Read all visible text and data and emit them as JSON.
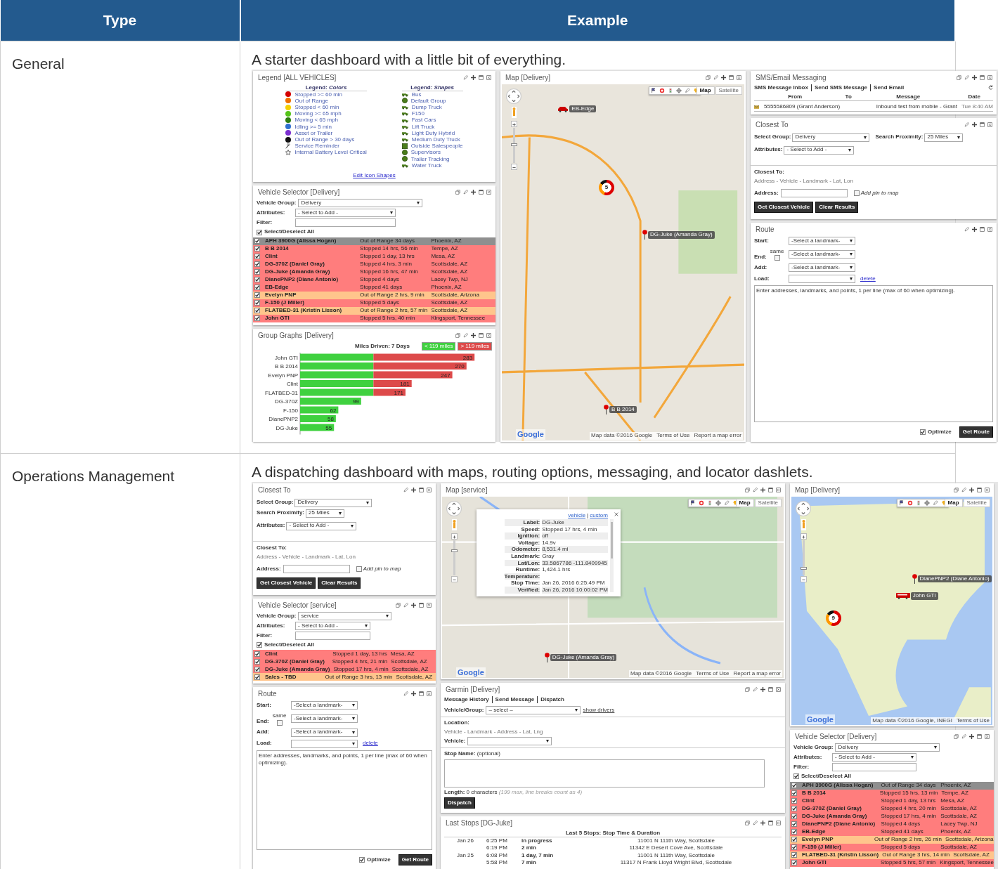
{
  "table": {
    "columns": [
      "Type",
      "Example"
    ],
    "rows": [
      {
        "type": "General",
        "description": "A starter dashboard with a little bit of everything.",
        "dashboard": {
          "columns": [
            [
              {
                "kind": "legend",
                "title": "Legend  [ALL VEHICLES]",
                "copyable": false,
                "colors_heading": "Legend: *Colors*",
                "colors": [
                  {
                    "kind": "dot",
                    "label": "Stopped >= 60 min",
                    "color": "#d40000"
                  },
                  {
                    "kind": "dot",
                    "label": "Out of Range",
                    "color": "#f07000"
                  },
                  {
                    "kind": "dot",
                    "label": "Stopped < 60 min",
                    "color": "#f5d000"
                  },
                  {
                    "kind": "dot",
                    "label": "Moving >= 65 mph",
                    "color": "#55c41a"
                  },
                  {
                    "kind": "dot",
                    "label": "Moving < 65 mph",
                    "color": "#2e7d10"
                  },
                  {
                    "kind": "dot",
                    "label": "Idling >= 5 min",
                    "color": "#2f6fd0"
                  },
                  {
                    "kind": "dot",
                    "label": "Asset or Trailer",
                    "color": "#7b2fd0"
                  },
                  {
                    "kind": "dot",
                    "label": "Out of Range > 30 days",
                    "color": "#111111"
                  },
                  {
                    "kind": "wrench",
                    "label": "Service Reminder"
                  },
                  {
                    "kind": "star",
                    "label": "Internal Battery Level Critical"
                  }
                ],
                "shapes_heading": "Legend: *Shapes*",
                "shapes": [
                  {
                    "kind": "vehicle",
                    "label": "Bus"
                  },
                  {
                    "kind": "circle",
                    "label": "Default Group"
                  },
                  {
                    "kind": "vehicle",
                    "label": "Dump Truck"
                  },
                  {
                    "kind": "vehicle",
                    "label": "F150"
                  },
                  {
                    "kind": "vehicle",
                    "label": "Fast Cars"
                  },
                  {
                    "kind": "vehicle",
                    "label": "Lift Truck"
                  },
                  {
                    "kind": "vehicle",
                    "label": "Light Duty Hybrid"
                  },
                  {
                    "kind": "vehicle",
                    "label": "Medium Duty Truck"
                  },
                  {
                    "kind": "square",
                    "label": "Outside Salespeople"
                  },
                  {
                    "kind": "circle",
                    "label": "Supervisors"
                  },
                  {
                    "kind": "circle",
                    "label": "Trailer Tracking"
                  },
                  {
                    "kind": "vehicle",
                    "label": "Water Truck"
                  }
                ],
                "link": "Edit Icon Shapes"
              },
              {
                "kind": "vehicle_selector",
                "title": "Vehicle Selector  [Delivery]",
                "copyable": true,
                "fields": [
                  {
                    "kind": "select",
                    "label": "Vehicle Group:",
                    "value": "Delivery"
                  },
                  {
                    "kind": "select",
                    "label": "Attributes:",
                    "value": "- Select to Add -"
                  },
                  {
                    "kind": "text",
                    "label": "Filter:"
                  }
                ],
                "select_all": {
                  "label": "Select/Deselect All",
                  "checked": true
                },
                "rows": [
                  {
                    "name": "APH 3900G (Alissa Hogan)",
                    "status": "Out of Range 34 days",
                    "location": "Phoenix, AZ",
                    "color": "#8f8f8f",
                    "checked": true
                  },
                  {
                    "name": "B B 2014",
                    "status": "Stopped 14 hrs, 56 min",
                    "location": "Tempe, AZ",
                    "color": "#ff7d7d",
                    "checked": true
                  },
                  {
                    "name": "Clint",
                    "status": "Stopped 1 day, 13 hrs",
                    "location": "Mesa, AZ",
                    "color": "#ff7d7d",
                    "checked": true
                  },
                  {
                    "name": "DG-370Z (Daniel Gray)",
                    "status": "Stopped 4 hrs, 3 min",
                    "location": "Scottsdale, AZ",
                    "color": "#ff7d7d",
                    "checked": true
                  },
                  {
                    "name": "DG-Juke (Amanda Gray)",
                    "status": "Stopped 16 hrs, 47 min",
                    "location": "Scottsdale, AZ",
                    "color": "#ff7d7d",
                    "checked": true
                  },
                  {
                    "name": "DianePNP2 (Diane Antonio)",
                    "status": "Stopped 4 days",
                    "location": "Lacey Twp, NJ",
                    "color": "#ff7d7d",
                    "checked": true
                  },
                  {
                    "name": "EB-Edge",
                    "status": "Stopped 41 days",
                    "location": "Phoenix, AZ",
                    "color": "#ff7d7d",
                    "checked": true
                  },
                  {
                    "name": "Evelyn PNP",
                    "status": "Out of Range 2 hrs, 9 min",
                    "location": "Scottsdale, Arizona",
                    "color": "#ffc58c",
                    "checked": true
                  },
                  {
                    "name": "F-150 (J Miller)",
                    "status": "Stopped 5 days",
                    "location": "Scottsdale, AZ",
                    "color": "#ff7d7d",
                    "checked": true
                  },
                  {
                    "name": "FLATBED-31 (Kristin Lisson)",
                    "status": "Out of Range 2 hrs, 57 min",
                    "location": "Scottsdale, AZ",
                    "color": "#ffc58c",
                    "checked": true
                  },
                  {
                    "name": "John GTI",
                    "status": "Stopped 5 hrs, 40 min",
                    "location": "Kingsport, Tennessee",
                    "color": "#ff7d7d",
                    "checked": true
                  }
                ]
              },
              {
                "kind": "group_graph",
                "title": "Group Graphs  [Delivery]",
                "copyable": true,
                "caption": "Miles Driven: 7 Days",
                "chart_data": {
                  "type": "bar",
                  "orientation": "horizontal",
                  "stacked": true,
                  "categories": [
                    "John GTI",
                    "B B 2014",
                    "Evelyn PNP",
                    "Clint",
                    "FLATBED-31",
                    "DG-370Z",
                    "F-150",
                    "DianePNP2",
                    "DG-Juke"
                  ],
                  "series": [
                    {
                      "name": "< 119 miles",
                      "color": "#3fd13f",
                      "values": [
                        119,
                        119,
                        119,
                        119,
                        119,
                        99,
                        62,
                        58,
                        55
                      ],
                      "value_labels": [
                        null,
                        null,
                        null,
                        null,
                        null,
                        "99",
                        "62",
                        "58",
                        "55"
                      ]
                    },
                    {
                      "name": "> 119 miles",
                      "color": "#dd4a4a",
                      "values": [
                        164,
                        151,
                        128,
                        62,
                        52,
                        null,
                        null,
                        null,
                        null
                      ]
                    }
                  ],
                  "annotations": [
                    {
                      "y": "John GTI",
                      "x": 283,
                      "text": "283"
                    },
                    {
                      "y": "B B 2014",
                      "x": 270,
                      "text": "270"
                    },
                    {
                      "y": "Evelyn PNP",
                      "x": 247,
                      "text": "247"
                    },
                    {
                      "y": "Clint",
                      "x": 181,
                      "text": "181"
                    },
                    {
                      "y": "FLATBED-31",
                      "x": 171,
                      "text": "171"
                    }
                  ]
                }
              }
            ],
            [
              {
                "kind": "map",
                "title": "Map  [Delivery]",
                "copyable": true,
                "zoom": {
                  "level": 0.52
                },
                "map_types": [
                  {
                    "label": "Map",
                    "selected": true
                  },
                  {
                    "label": "Satellite",
                    "selected": false
                  }
                ],
                "markers": [
                  {
                    "kind": "car",
                    "label": "EB-Edge"
                  },
                  {
                    "kind": "cluster",
                    "label": "5"
                  },
                  {
                    "kind": "pin",
                    "label": "DG-Juke (Amanda Gray)"
                  },
                  {
                    "kind": "pin",
                    "label": "B B 2014"
                  }
                ],
                "logo": "Google",
                "attribution": [
                  "Map data ©2016 Google",
                  "Terms of Use",
                  "Report a map error"
                ]
              }
            ],
            [
              {
                "kind": "sms",
                "title": "SMS/Email Messaging",
                "copyable": true,
                "tabs": [
                  "SMS Message Inbox",
                  "Send SMS Message",
                  "Send Email"
                ],
                "columns": [
                  "From",
                  "To",
                  "Message",
                  "Date"
                ],
                "rows": [
                  {
                    "from": "5555586809 (Grant Anderson)",
                    "message": "Inbound test from mobile - Grant",
                    "date": "Tue 8:40 AM"
                  }
                ]
              },
              {
                "kind": "closest_to",
                "title": "Closest To",
                "copyable": false,
                "fields": [
                  {
                    "kind": "select",
                    "label": "Select Group:",
                    "value": "Delivery"
                  },
                  {
                    "kind": "select",
                    "label": "Search Proximity:",
                    "value": "25 Miles"
                  },
                  {
                    "kind": "select",
                    "label": "Attributes:",
                    "value": "- Select to Add -"
                  }
                ],
                "target_heading": "Closest To:",
                "target_options": "Address  -  Vehicle  -  Landmark  -  Lat, Lon",
                "address_label": "Address:",
                "pin_option": {
                  "label": "Add pin to map",
                  "checked": false
                },
                "buttons": [
                  "Get Closest Vehicle",
                  "Clear Results"
                ]
              },
              {
                "kind": "route",
                "title": "Route",
                "copyable": false,
                "fields": [
                  {
                    "label": "Start:",
                    "value": "-Select a landmark-"
                  },
                  {
                    "label": "End:",
                    "value": "-Select a landmark-",
                    "same": {
                      "label": "same",
                      "checked": false
                    }
                  },
                  {
                    "label": "Add:",
                    "value": "-Select a landmark-"
                  },
                  {
                    "label": "Load:",
                    "link": "delete"
                  }
                ],
                "placeholder": "Enter addresses, landmarks, and points, 1 per line (max of 60 when optimizing).",
                "optimize": {
                  "label": "Optimize",
                  "checked": true
                },
                "button": "Get Route"
              }
            ]
          ]
        }
      },
      {
        "type": "Operations Management",
        "description": "A dispatching dashboard with maps, routing options, messaging, and locator dashlets.",
        "dashboard": {
          "columns": [
            [
              {
                "kind": "closest_to",
                "title": "Closest To",
                "copyable": false,
                "fields": [
                  {
                    "kind": "select",
                    "label": "Select Group:",
                    "value": "Delivery"
                  },
                  {
                    "kind": "select",
                    "label": "Search Proximity:",
                    "value": "25 Miles"
                  },
                  {
                    "kind": "select",
                    "label": "Attributes:",
                    "value": "- Select to Add -"
                  }
                ],
                "target_heading": "Closest To:",
                "target_options": "Address  -  Vehicle  -  Landmark  -  Lat, Lon",
                "address_label": "Address:",
                "pin_option": {
                  "label": "Add pin to map",
                  "checked": false
                },
                "buttons": [
                  "Get Closest Vehicle",
                  "Clear Results"
                ]
              },
              {
                "kind": "vehicle_selector",
                "title": "Vehicle Selector  [service]",
                "copyable": true,
                "fields": [
                  {
                    "kind": "select",
                    "label": "Vehicle Group:",
                    "value": "service"
                  },
                  {
                    "kind": "select",
                    "label": "Attributes:",
                    "value": "- Select to Add -"
                  },
                  {
                    "kind": "text",
                    "label": "Filter:"
                  }
                ],
                "select_all": {
                  "label": "Select/Deselect All",
                  "checked": true
                },
                "rows": [
                  {
                    "name": "Clint",
                    "status": "Stopped 1 day, 13 hrs",
                    "location": "Mesa, AZ",
                    "color": "#ff7d7d",
                    "checked": true
                  },
                  {
                    "name": "DG-370Z (Daniel Gray)",
                    "status": "Stopped 4 hrs, 21 min",
                    "location": "Scottsdale, AZ",
                    "color": "#ff7d7d",
                    "checked": true
                  },
                  {
                    "name": "DG-Juke (Amanda Gray)",
                    "status": "Stopped 17 hrs, 4 min",
                    "location": "Scottsdale, AZ",
                    "color": "#ff7d7d",
                    "checked": true
                  },
                  {
                    "name": "Sales - TBD",
                    "status": "Out of Range 3 hrs, 13 min",
                    "location": "Scottsdale, AZ",
                    "color": "#ffc58c",
                    "checked": true
                  }
                ]
              },
              {
                "kind": "route",
                "title": "Route",
                "copyable": false,
                "fields": [
                  {
                    "label": "Start:",
                    "value": "-Select a landmark-"
                  },
                  {
                    "label": "End:",
                    "value": "-Select a landmark-",
                    "same": {
                      "label": "same",
                      "checked": false
                    }
                  },
                  {
                    "label": "Add:",
                    "value": "-Select a landmark-"
                  },
                  {
                    "label": "Load:",
                    "link": "delete"
                  }
                ],
                "placeholder": "Enter addresses, landmarks, and points, 1 per line (max of 60 when optimizing).",
                "optimize": {
                  "label": "Optimize",
                  "checked": true
                },
                "button": "Get Route"
              }
            ],
            [
              {
                "kind": "map",
                "title": "Map  [service]",
                "copyable": true,
                "zoom": {
                  "level": 0.69
                },
                "map_types": [
                  {
                    "label": "Map",
                    "selected": true
                  },
                  {
                    "label": "Satellite",
                    "selected": false
                  }
                ],
                "markers": [
                  {
                    "kind": "pin",
                    "label": "DG-Juke (Amanda Gray)"
                  }
                ],
                "popup": {
                  "links": [
                    "vehicle",
                    "custom"
                  ],
                  "separator": "|",
                  "fields": [
                    {
                      "label": "Label:",
                      "value": "DG-Juke"
                    },
                    {
                      "label": "Speed:",
                      "value": "Stopped 17 hrs, 4 min"
                    },
                    {
                      "label": "Ignition:",
                      "value": "off"
                    },
                    {
                      "label": "Voltage:",
                      "value": "14.9v"
                    },
                    {
                      "label": "Odometer:",
                      "value": "8,531.4 mi"
                    },
                    {
                      "label": "Landmark:",
                      "value": "Gray"
                    },
                    {
                      "label": "Lat/Lon:",
                      "value": "33.5867786 -111.8409945"
                    },
                    {
                      "label": "Runtime:",
                      "value": "1,424.1 hrs"
                    },
                    {
                      "label": "Temperature:"
                    },
                    {
                      "label": "Stop Time:",
                      "value": "Jan 26, 2016 6:25:49 PM"
                    },
                    {
                      "label": "Verified:",
                      "value": "Jan 26, 2016 10:00:02 PM"
                    }
                  ]
                },
                "logo": "Google",
                "attribution": [
                  "Map data ©2016 Google",
                  "Terms of Use",
                  "Report a map error"
                ]
              },
              {
                "kind": "garmin",
                "title": "Garmin  [Delivery]",
                "copyable": true,
                "tabs": [
                  "Message History",
                  "Send Message",
                  "Dispatch"
                ],
                "vehicle_group": {
                  "label": "Vehicle/Group:",
                  "value": "– select –",
                  "link": "show drivers"
                },
                "location_heading": "Location:",
                "location_options": "Vehicle  -  Landmark  -  Address  -  Lat, Lng",
                "vehicle_label": "Vehicle:",
                "stop_name": "**Stop Name:** (optional)",
                "length": "**Length:** 0 characters *(199 max, line breaks count as 4)*",
                "button": "Dispatch"
              },
              {
                "kind": "last_stops",
                "title": "Last Stops  [DG-Juke]",
                "copyable": true,
                "heading": "Last 5 Stops: Stop Time & Duration",
                "rows": [
                  {
                    "date": "Jan 26",
                    "time": "6:25 PM",
                    "duration": "in progress",
                    "address": "11001 N 111th Way, Scottsdale"
                  },
                  {
                    "time": "6:19 PM",
                    "duration": "2 min",
                    "address": "11342 E Desert Cove Ave, Scottsdale"
                  },
                  {
                    "date": "Jan 25",
                    "time": "6:08 PM",
                    "duration": "1 day, 7 min",
                    "address": "11001 N 111th Way, Scottsdale"
                  },
                  {
                    "time": "5:58 PM",
                    "duration": "7 min",
                    "address": "11317 N Frank Lloyd Wright Blvd, Scottsdale"
                  }
                ]
              }
            ],
            [
              {
                "kind": "map",
                "title": "Map  [Delivery]",
                "copyable": true,
                "zoom": {
                  "level": 0.2
                },
                "map_types": [
                  {
                    "label": "Map",
                    "selected": true
                  },
                  {
                    "label": "Satellite",
                    "selected": false
                  }
                ],
                "markers": [
                  {
                    "kind": "cluster",
                    "label": "9"
                  },
                  {
                    "kind": "pin",
                    "label": "DianePNP2 (Diane Antonio)"
                  },
                  {
                    "kind": "bus",
                    "label": "John GTI"
                  }
                ],
                "logo": "Google",
                "attribution": [
                  "Map data ©2016 Google, INEGI",
                  "Terms of Use"
                ]
              },
              {
                "kind": "vehicle_selector",
                "title": "Vehicle Selector  [Delivery]",
                "copyable": true,
                "fields": [
                  {
                    "kind": "select",
                    "label": "Vehicle Group:",
                    "value": "Delivery"
                  },
                  {
                    "kind": "select",
                    "label": "Attributes:",
                    "value": "- Select to Add -"
                  },
                  {
                    "kind": "text",
                    "label": "Filter:"
                  }
                ],
                "select_all": {
                  "label": "Select/Deselect All",
                  "checked": true
                },
                "rows": [
                  {
                    "name": "APH 3900G (Alissa Hogan)",
                    "status": "Out of Range 34 days",
                    "location": "Phoenix, AZ",
                    "color": "#8f8f8f",
                    "checked": true
                  },
                  {
                    "name": "B B 2014",
                    "status": "Stopped 15 hrs, 13 min",
                    "location": "Tempe, AZ",
                    "color": "#ff7d7d",
                    "checked": true
                  },
                  {
                    "name": "Clint",
                    "status": "Stopped 1 day, 13 hrs",
                    "location": "Mesa, AZ",
                    "color": "#ff7d7d",
                    "checked": true
                  },
                  {
                    "name": "DG-370Z (Daniel Gray)",
                    "status": "Stopped 4 hrs, 20 min",
                    "location": "Scottsdale, AZ",
                    "color": "#ff7d7d",
                    "checked": true
                  },
                  {
                    "name": "DG-Juke (Amanda Gray)",
                    "status": "Stopped 17 hrs, 4 min",
                    "location": "Scottsdale, AZ",
                    "color": "#ff7d7d",
                    "checked": true
                  },
                  {
                    "name": "DianePNP2 (Diane Antonio)",
                    "status": "Stopped 4 days",
                    "location": "Lacey Twp, NJ",
                    "color": "#ff7d7d",
                    "checked": true
                  },
                  {
                    "name": "EB-Edge",
                    "status": "Stopped 41 days",
                    "location": "Phoenix, AZ",
                    "color": "#ff7d7d",
                    "checked": true
                  },
                  {
                    "name": "Evelyn PNP",
                    "status": "Out of Range 2 hrs, 26 min",
                    "location": "Scottsdale, Arizona",
                    "color": "#ffc58c",
                    "checked": true
                  },
                  {
                    "name": "F-150 (J Miller)",
                    "status": "Stopped 5 days",
                    "location": "Scottsdale, AZ",
                    "color": "#ff7d7d",
                    "checked": true
                  },
                  {
                    "name": "FLATBED-31 (Kristin Lisson)",
                    "status": "Out of Range 3 hrs, 14 min",
                    "location": "Scottsdale, AZ",
                    "color": "#ffc58c",
                    "checked": true
                  },
                  {
                    "name": "John GTI",
                    "status": "Stopped 5 hrs, 57 min",
                    "location": "Kingsport, Tennessee",
                    "color": "#ff7d7d",
                    "checked": true
                  }
                ]
              }
            ]
          ]
        }
      }
    ]
  }
}
